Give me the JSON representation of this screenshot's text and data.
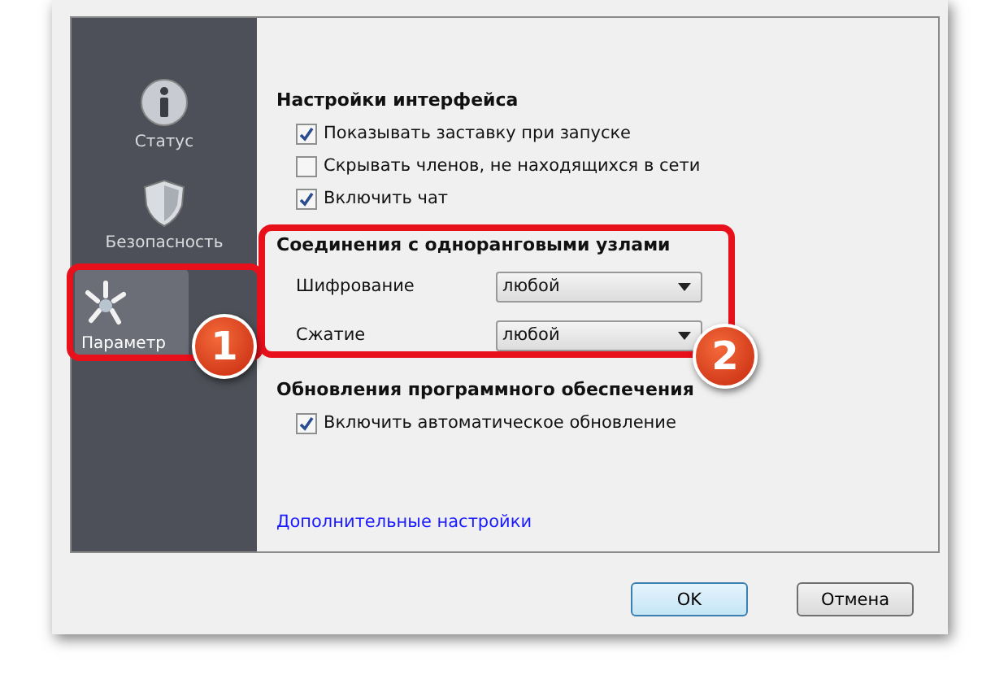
{
  "sidebar": {
    "items": [
      {
        "label": "Статус",
        "kind": "info",
        "selected": false
      },
      {
        "label": "Безопасность",
        "kind": "shield",
        "selected": false
      },
      {
        "label": "Параметр",
        "kind": "gear",
        "selected": true
      }
    ]
  },
  "sections": [
    {
      "title": "Настройки интерфейса",
      "rows": [
        {
          "kind": "checkbox",
          "label": "Показывать заставку при запуске",
          "checked": true
        },
        {
          "kind": "checkbox",
          "label": "Скрывать членов, не находящихся в сети",
          "checked": false
        },
        {
          "kind": "checkbox",
          "label": "Включить чат",
          "checked": true
        }
      ]
    },
    {
      "title": "Соединения с одноранговыми узлами",
      "rows": [
        {
          "kind": "select",
          "label": "Шифрование",
          "value": "любой"
        },
        {
          "kind": "select",
          "label": "Сжатие",
          "value": "любой"
        }
      ]
    },
    {
      "title": "Обновления программного обеспечения",
      "rows": [
        {
          "kind": "checkbox",
          "label": "Включить автоматическое обновление",
          "checked": true
        }
      ]
    }
  ],
  "link": "Дополнительные настройки",
  "buttons": [
    {
      "label": "OK",
      "default": true
    },
    {
      "label": "Отмена",
      "default": false
    }
  ],
  "annotations": [
    {
      "label": "1"
    },
    {
      "label": "2"
    }
  ]
}
